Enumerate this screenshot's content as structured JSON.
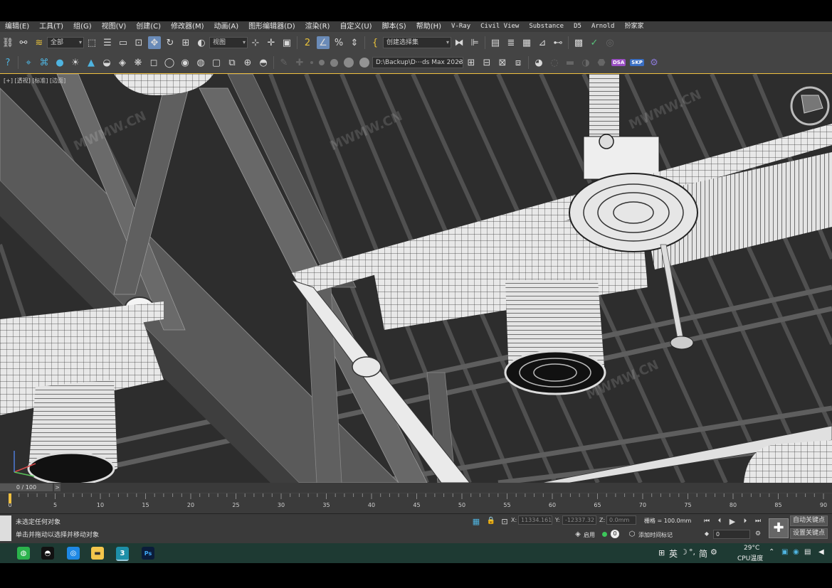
{
  "menubar": [
    "编辑(E)",
    "工具(T)",
    "组(G)",
    "视图(V)",
    "创建(C)",
    "修改器(M)",
    "动画(A)",
    "图形编辑器(D)",
    "渲染(R)",
    "自定义(U)",
    "脚本(S)",
    "帮助(H)",
    "V-Ray",
    "Civil View",
    "Substance",
    "D5",
    "Arnold",
    "扮家家"
  ],
  "toolbar1": {
    "filter_value": "全部",
    "coord_system": "视图",
    "selection_set": "创建选择集"
  },
  "toolbar2": {
    "path_value": "D:\\Backup\\D⋯ds Max 2023",
    "badges": [
      "DSA",
      "SKP"
    ]
  },
  "viewport": {
    "label": "[+] [透视] [标准] [边面]",
    "watermarks": [
      "MWMW.CN",
      "MWMW.CN",
      "MWMW.CN",
      "MWMW.CN"
    ]
  },
  "timeline": {
    "frame_display": "0 / 100",
    "arrow": ">",
    "ticks": [
      "0",
      "5",
      "10",
      "15",
      "20",
      "25",
      "30",
      "35",
      "40",
      "45",
      "50",
      "55",
      "60",
      "65",
      "70",
      "75",
      "80",
      "85",
      "90"
    ]
  },
  "status": {
    "selection": "未选定任何对象",
    "hint": "单击并拖动以选择并移动对象",
    "x_label": "X:",
    "x_value": "11334.161",
    "y_label": "Y:",
    "y_value": "-12337.32",
    "z_label": "Z:",
    "z_value": "0.0mm",
    "grid": "栅格 = 100.0mm",
    "enable": "启用",
    "enable_value": "0",
    "add_time_tag": "添加时间标记",
    "auto_key": "自动关键点",
    "set_key": "设置关键点",
    "frame_field": "0"
  },
  "taskbar": {
    "apps": [
      "WeChat",
      "QQ",
      "Browser",
      "Files",
      "3ds Max",
      "Photoshop"
    ],
    "max_label": "3",
    "ps_label": "Ps",
    "ime": "英",
    "ime2": "简",
    "temperature": "29°C",
    "cpu_label": "CPU温度"
  },
  "colors": {
    "accent": "#f0c040",
    "active_tool": "#6a8bb8",
    "taskbar": "#1e3a33"
  }
}
